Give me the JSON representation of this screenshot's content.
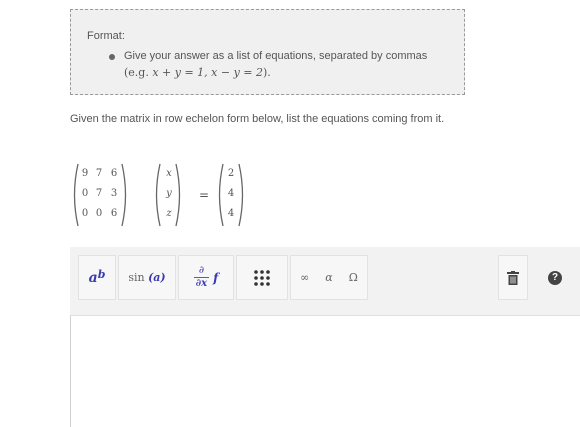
{
  "format": {
    "heading": "Format:",
    "bullet_text": "Give your answer as a list of equations, separated by commas",
    "example_prefix": "(e.g. ",
    "example_math": "x + y = 1, x − y = 2",
    "example_suffix": ")."
  },
  "question": "Given the matrix in row echelon form below, list the equations coming from it.",
  "matrix": {
    "coefficients": [
      [
        "9",
        "7",
        "6"
      ],
      [
        "0",
        "7",
        "3"
      ],
      [
        "0",
        "0",
        "6"
      ]
    ],
    "variables": [
      "x",
      "y",
      "z"
    ],
    "constants": [
      "2",
      "4",
      "4"
    ],
    "equals": "="
  },
  "toolbar": {
    "superscript_base": "a",
    "superscript_exp": "b",
    "sin_label": "sin",
    "sin_arg": "(a)",
    "deriv_num": "∂",
    "deriv_den": "∂x",
    "deriv_f": "f",
    "infinity": "∞",
    "alpha": "α",
    "omega": "Ω",
    "help": "?"
  },
  "answer_value": ""
}
